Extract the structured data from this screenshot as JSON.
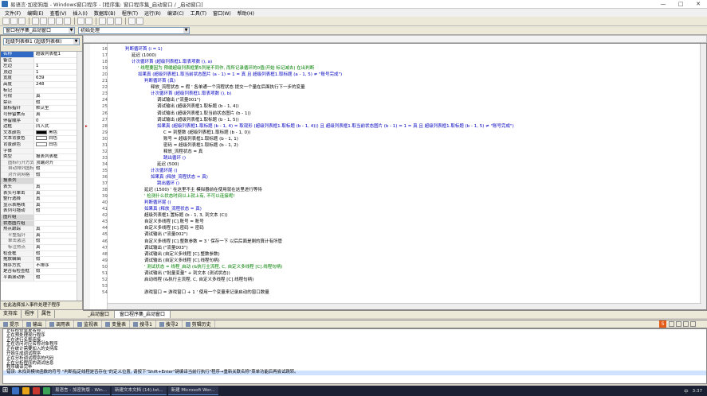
{
  "window": {
    "title": "易语言·加密狗版 - Windows窗口程序 - [程序集: 窗口程序集_启动窗口 / _启动窗口]",
    "minimize": "—",
    "maximize": "□",
    "close": "✕"
  },
  "menu": [
    "文件(F)",
    "编辑(E)",
    "查看(V)",
    "插入(I)",
    "数据库(B)",
    "程序(T)",
    "运行(R)",
    "编译(C)",
    "工具(T)",
    "窗口(W)",
    "帮助(H)"
  ],
  "toolbar": {
    "buttons": [
      "new",
      "open",
      "save",
      "cut",
      "copy",
      "paste",
      "undo",
      "redo",
      "find",
      "replace",
      "run",
      "stop",
      "step",
      "compile",
      "pin"
    ]
  },
  "selectors": {
    "left_value": "窗口程序集_启动窗口",
    "right_value": "初始处理"
  },
  "left_panel": {
    "header_value": "超级列表框1 (超级列表框)",
    "props": [
      {
        "k": "名称",
        "v": "超级列表框1",
        "cls": "selrow"
      },
      {
        "k": "备注",
        "v": ""
      },
      {
        "k": "左边",
        "v": "1"
      },
      {
        "k": "顶边",
        "v": "1"
      },
      {
        "k": "宽度",
        "v": "639"
      },
      {
        "k": "高度",
        "v": "248"
      },
      {
        "k": "标记",
        "v": ""
      },
      {
        "k": "可视",
        "v": "真"
      },
      {
        "k": "禁止",
        "v": "假"
      },
      {
        "k": "鼠标指针",
        "v": "默认型"
      },
      {
        "k": "可停留焦点",
        "v": "真"
      },
      {
        "k": "停留顺序",
        "v": "0"
      },
      {
        "k": "边框",
        "v": "凹入式"
      },
      {
        "k": "文本颜色",
        "v": "黑色",
        "swatch": "#000000"
      },
      {
        "k": "文本背景色",
        "v": "白色",
        "swatch": "#ffffff"
      },
      {
        "k": "背景颜色",
        "v": "白色",
        "swatch": "#ffffff"
      },
      {
        "k": "字体",
        "v": ""
      },
      {
        "k": "类型",
        "v": "报表列表框"
      },
      {
        "k": "图标行开方式",
        "v": "顶端对齐",
        "cls": "sub"
      },
      {
        "k": "自动排列图标",
        "v": "假",
        "cls": "sub"
      },
      {
        "k": "对齐到网格",
        "v": "假",
        "cls": "sub"
      },
      {
        "k": "报表列",
        "v": "",
        "cls": "sect"
      },
      {
        "k": "表头",
        "v": "真"
      },
      {
        "k": "表头可单击",
        "v": "真"
      },
      {
        "k": "整行选择",
        "v": "真"
      },
      {
        "k": "显示表格线",
        "v": "真"
      },
      {
        "k": "表列可拖动",
        "v": "假"
      },
      {
        "k": "图片组",
        "v": "",
        "cls": "sect"
      },
      {
        "k": "状态图片组",
        "v": "",
        "cls": "sect"
      },
      {
        "k": "热点跟踪",
        "v": "真"
      },
      {
        "k": "平整指针",
        "v": "真",
        "cls": "sub"
      },
      {
        "k": "单击激活",
        "v": "假",
        "cls": "sub"
      },
      {
        "k": "标注热点",
        "v": "真",
        "cls": "sub"
      },
      {
        "k": "检查框",
        "v": "假"
      },
      {
        "k": "拖放编辑",
        "v": "假"
      },
      {
        "k": "排序方式",
        "v": "不排序"
      },
      {
        "k": "是否有检查框",
        "v": "假"
      },
      {
        "k": "平面滚动条",
        "v": "假"
      }
    ],
    "add_event": "在此选择加入事件处理子程序",
    "tabs": [
      "支持库",
      "程序",
      "属性"
    ]
  },
  "code_lines": [
    {
      "n": "16",
      "i": 0,
      "t": "判断循环首 (i = 1)",
      "c": "c-blue"
    },
    {
      "n": "17",
      "i": 1,
      "t": "延迟 (1000)",
      "c": "c-black"
    },
    {
      "n": "18",
      "i": 1,
      "t": "计次循环首 (超级列表框1.取表项数 (), a)",
      "c": "c-blue"
    },
    {
      "n": "19",
      "i": 2,
      "t": "' 线程要因为 预缓超级列表框第5列是不同作, 而所记录循环的0值(开始 标记减去) 在出判断",
      "c": "c-green"
    },
    {
      "n": "20",
      "i": 2,
      "t": "如果真 (超级列表框1.取当前状态图片 (a - 1) = 1 = 真 且 超级列表框1.取标题 (a - 1, 5) ≠ \"账号完成\")",
      "c": "c-blue"
    },
    {
      "n": "21",
      "i": 3,
      "t": "判断循环首 (真)",
      "c": "c-blue"
    },
    {
      "n": "22",
      "i": 4,
      "t": "释放_流程状态 = 假  ' 各单通一个流程状态 提交一个量在后面执行下一步的变量",
      "c": "c-black"
    },
    {
      "n": "23",
      "i": 4,
      "t": "计次循环首 (超级列表框1.取表项数 (), b)",
      "c": "c-blue"
    },
    {
      "n": "24",
      "i": 5,
      "t": "调试输出 (\"流量001\")",
      "c": "c-black"
    },
    {
      "n": "25",
      "i": 5,
      "t": "调试输出 (超级列表框1.取标题 (b - 1, 4))",
      "c": "c-black"
    },
    {
      "n": "26",
      "i": 5,
      "t": "调试输出 (超级列表框1.取当前状态图片 (b - 1))",
      "c": "c-black"
    },
    {
      "n": "27",
      "i": 5,
      "t": "调试输出 (超级列表框1.取标题 (b - 1, 5))",
      "c": "c-black"
    },
    {
      "n": "28",
      "i": 5,
      "t": "如果真 (超级列表框1.取标题 (b - 1, 4) = 取现形 (超级列表框1.取标题 (b - 1, 4))) 且 超级列表框1.取当前状态图片 (b - 1) = 1 = 真 且 超级列表框1.取标题 (b - 1, 5) ≠ \"账号完成\")",
      "c": "c-blue"
    },
    {
      "n": "29",
      "i": 6,
      "t": "C = 到整数 (超级列表框1.取标题 (b - 1, 0))",
      "c": "c-black"
    },
    {
      "n": "30",
      "i": 6,
      "t": "账号 = 超级列表框1.取标题 (b - 1, 1)",
      "c": "c-black"
    },
    {
      "n": "31",
      "i": 6,
      "t": "密码 = 超级列表框1.取标题 (b - 1, 2)",
      "c": "c-black"
    },
    {
      "n": "32",
      "i": 6,
      "t": "释放_流程状态 = 真",
      "c": "c-black"
    },
    {
      "n": "33",
      "i": 6,
      "t": "跳出循环 ()",
      "c": "c-blue"
    },
    {
      "n": "34",
      "i": 5,
      "t": "延迟 (500)",
      "c": "c-black"
    },
    {
      "n": "35",
      "i": 4,
      "t": "计次循环尾 ()",
      "c": "c-blue"
    },
    {
      "n": "36",
      "i": 4,
      "t": "如果真 (释放_流程状态 = 真)",
      "c": "c-blue"
    },
    {
      "n": "37",
      "i": 5,
      "t": "跳出循环 ()",
      "c": "c-blue"
    },
    {
      "n": "38",
      "i": 3,
      "t": "延迟 (1500)  ' 在这里不主 模拟器前在使用就在这里进行等待",
      "c": "c-black"
    },
    {
      "n": "39",
      "i": 3,
      "t": "' 检测什么状态时间以上就上有, 不可以连接呢!",
      "c": "c-green"
    },
    {
      "n": "40",
      "i": 3,
      "t": "判断循环尾 ()",
      "c": "c-blue"
    },
    {
      "n": "41",
      "i": 3,
      "t": "如果真 (释放_流程状态 = 真)",
      "c": "c-blue"
    },
    {
      "n": "42",
      "i": 3,
      "t": "超级列表框1.置标题 (b - 1, 3, 到文本 (C))",
      "c": "c-black"
    },
    {
      "n": "43",
      "i": 3,
      "t": "自定义多线程 [C].账号 = 账号",
      "c": "c-black"
    },
    {
      "n": "44",
      "i": 3,
      "t": "自定义多线程 [C].密码 = 密码",
      "c": "c-black"
    },
    {
      "n": "45",
      "i": 3,
      "t": "调试输出 (\"流量002\")",
      "c": "c-black"
    },
    {
      "n": "46",
      "i": 3,
      "t": "自定义多线程 [C].整数参数 = 3  ' 保存一下 以后后面是剩的算计有所管",
      "c": "c-black"
    },
    {
      "n": "47",
      "i": 3,
      "t": "调试输出 (\"流量003\")",
      "c": "c-black"
    },
    {
      "n": "48",
      "i": 3,
      "t": "调试输出 (自定义多线程 [C].整数参数)",
      "c": "c-black"
    },
    {
      "n": "49",
      "i": 3,
      "t": "调试输出 (自定义多线程 [C].线程句柄)",
      "c": "c-black"
    },
    {
      "n": "50",
      "i": 3,
      "t": "' 测试状态 = 线程_启动 (&执行主流程, C, 自定义多线程 [C].线程句柄)",
      "c": "c-green"
    },
    {
      "n": "51",
      "i": 3,
      "t": "调试输出 (\"批量变量\" + 到文本 (测试状态))",
      "c": "c-black"
    },
    {
      "n": "52",
      "i": 3,
      "t": "启动线程 (&执行主流程, C, 自定义多线程 [C].线程句柄)",
      "c": "c-black"
    },
    {
      "n": "53",
      "i": 2,
      "t": "",
      "c": "c-black"
    },
    {
      "n": "54",
      "i": 3,
      "t": "游戏窗口 = 游戏窗口 + 1  ' 使用一个变量来记录启动的窗口数量",
      "c": "c-black"
    }
  ],
  "code_tabs": [
    "_启动窗口",
    "窗口程序集_启动窗口"
  ],
  "bottom_tabs": [
    "提示",
    "输出",
    "调用表",
    "监视表",
    "变量表",
    "搜寻1",
    "搜寻2",
    "剪辑历史"
  ],
  "output_lines": [
    {
      "t": "正在检查重复名称...",
      "hl": false
    },
    {
      "t": "正在预处理现行程序",
      "hl": false
    },
    {
      "t": "正在进行名称连接...",
      "hl": false
    },
    {
      "t": "正在访问对应名称对象程序",
      "hl": false
    },
    {
      "t": "正在统计需要加入的支持库",
      "hl": false
    },
    {
      "t": "开始生成调试程序",
      "hl": false
    },
    {
      "t": "正在分析调试程序的代码",
      "hl": false
    },
    {
      "t": "正在分析程序的调试信息",
      "hl": false
    },
    {
      "t": "程序编译完毕",
      "hl": false
    },
    {
      "t": "错误: 未找到模块函数的符号 \"判断指定线程是否存在\"的定义位置, 请按下\"Shift+Enter\"键编译当前行执行\"程序→重新关联名称\"菜单功能后再尝试跳转。",
      "hl": true
    }
  ],
  "ime": {
    "label": "S"
  },
  "taskbar": {
    "items": [
      "易语言 - 加密狗版 - Win...",
      "新建文本文档 (14).txt...",
      "新建 Microsoft Wor..."
    ],
    "tray": {
      "lang": "中",
      "time": "3:37"
    }
  }
}
